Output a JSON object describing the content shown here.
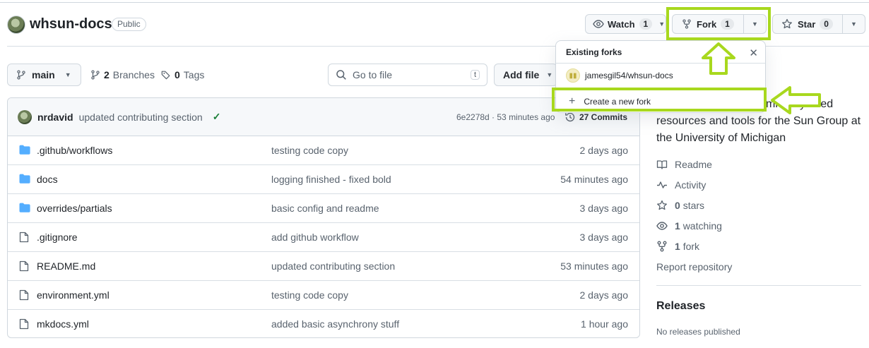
{
  "repo": {
    "name": "whsun-docs",
    "visibility": "Public"
  },
  "header_actions": {
    "watch_label": "Watch",
    "watch_count": "1",
    "fork_label": "Fork",
    "fork_count": "1",
    "star_label": "Star",
    "star_count": "0"
  },
  "toolbar": {
    "branch": "main",
    "branches_count": "2",
    "branches_label": "Branches",
    "tags_count": "0",
    "tags_label": "Tags",
    "goto_placeholder": "Go to file",
    "goto_shortcut": "t",
    "add_file_label": "Add file"
  },
  "latest_commit": {
    "author": "nrdavid",
    "message": "updated contributing section",
    "status": "✓",
    "sha_time": "6e2278d · 53 minutes ago",
    "commits_label": "27 Commits"
  },
  "files": [
    {
      "type": "folder",
      "name": ".github/workflows",
      "message": "testing code copy",
      "time": "2 days ago"
    },
    {
      "type": "folder",
      "name": "docs",
      "message": "logging finished - fixed bold",
      "time": "54 minutes ago"
    },
    {
      "type": "folder",
      "name": "overrides/partials",
      "message": "basic config and readme",
      "time": "3 days ago"
    },
    {
      "type": "file",
      "name": ".gitignore",
      "message": "add github workflow",
      "time": "3 days ago"
    },
    {
      "type": "file",
      "name": "README.md",
      "message": "updated contributing section",
      "time": "53 minutes ago"
    },
    {
      "type": "file",
      "name": "environment.yml",
      "message": "testing code copy",
      "time": "2 days ago"
    },
    {
      "type": "file",
      "name": "mkdocs.yml",
      "message": "added basic asynchrony stuff",
      "time": "1 hour ago"
    }
  ],
  "sidebar": {
    "about_text": "...mmonly used resources and tools for the Sun Group at the University of Michigan",
    "about_line1": "mmonly used",
    "about_line2": "resources and tools for the Sun Group at",
    "about_line3": "the University of Michigan",
    "readme": "Readme",
    "activity": "Activity",
    "stars_count": "0",
    "stars_label": "stars",
    "watching_count": "1",
    "watching_label": "watching",
    "fork_count": "1",
    "fork_label": "fork",
    "report": "Report repository",
    "releases_title": "Releases",
    "no_releases": "No releases published"
  },
  "fork_dropdown": {
    "title": "Existing forks",
    "existing_fork": "jamesgil54/whsun-docs",
    "create_label": "Create a new fork"
  },
  "colors": {
    "highlight": "#a8d81e",
    "folder": "#54aeff",
    "success": "#1a7f37"
  }
}
